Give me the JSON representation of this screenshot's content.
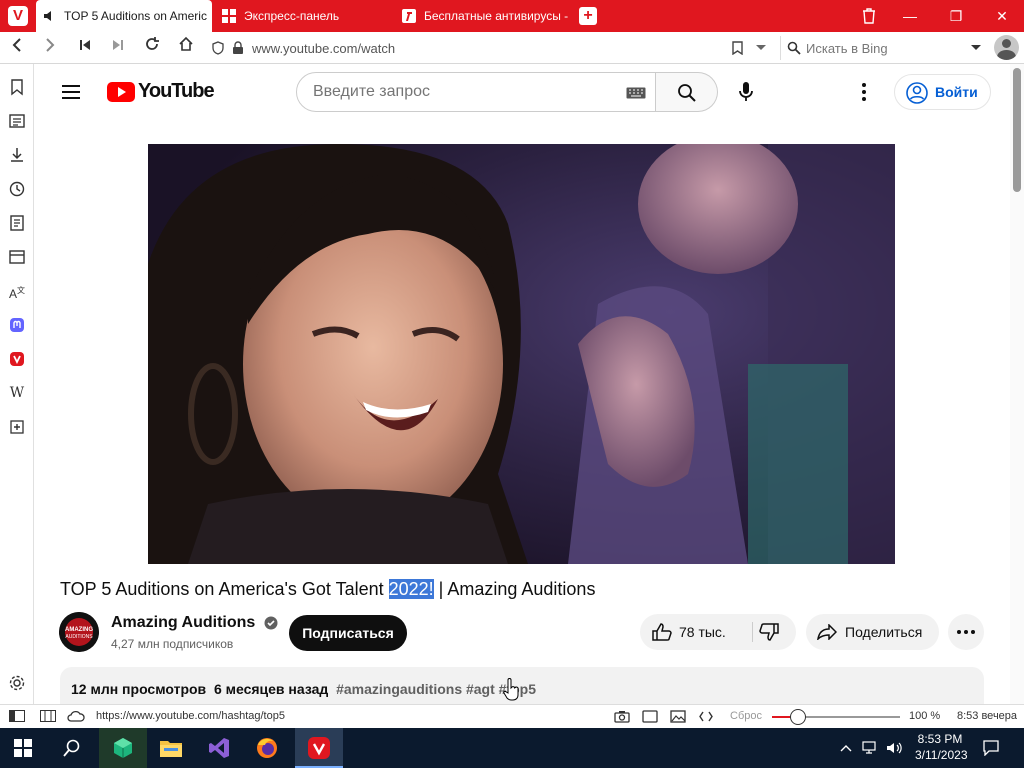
{
  "browser": {
    "tabs": [
      {
        "title": "TOP 5 Auditions on Americ",
        "active": true,
        "icon": "speaker-icon"
      },
      {
        "title": "Экспресс-панель",
        "active": false,
        "icon": "grid-icon"
      },
      {
        "title": "Бесплатные антивирусы -",
        "active": false,
        "icon": "antivirus-icon"
      }
    ],
    "url": "www.youtube.com/watch",
    "search_placeholder": "Искать в Bing",
    "accent": "#e0171f"
  },
  "youtube": {
    "logo": "YouTube",
    "search_placeholder": "Введите запрос",
    "signin_label": "Войти"
  },
  "video": {
    "title_before": "TOP 5 Auditions on America's Got Talent ",
    "title_highlight": "2022!",
    "title_after": " | Amazing Auditions",
    "channel": "Amazing Auditions",
    "subscribers": "4,27 млн подписчиков",
    "subscribe_label": "Подписаться",
    "likes": "78 тыс.",
    "share_label": "Поделиться",
    "views": "12 млн просмотров",
    "age": "6 месяцев назад",
    "tags": "#amazingauditions #agt #top5"
  },
  "statusbar": {
    "link_url": "https://www.youtube.com/hashtag/top5",
    "reset_label": "Сброс",
    "zoom": "100 %",
    "time": "8:53 вечера",
    "zoom_level": 0.2
  },
  "taskbar": {
    "time": "8:53 PM",
    "date": "3/11/2023"
  }
}
